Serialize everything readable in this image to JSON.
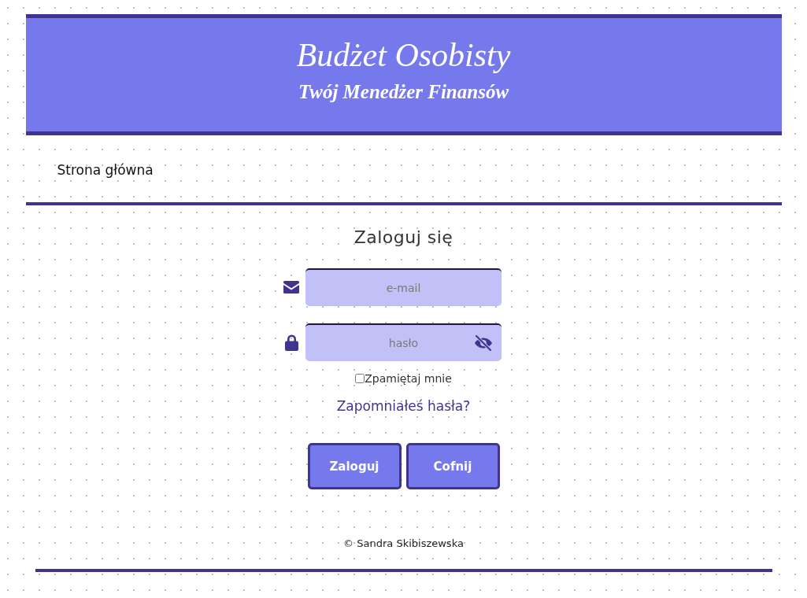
{
  "header": {
    "title": "Budżet Osobisty",
    "subtitle": "Twój Menedżer Finansów"
  },
  "nav": [
    {
      "label": "Strona główna"
    }
  ],
  "login": {
    "heading": "Zaloguj się",
    "fields": [
      {
        "kind": "email",
        "placeholder": "e-mail"
      },
      {
        "kind": "password",
        "placeholder": "hasło",
        "password_visible": false
      }
    ],
    "remember": {
      "label": "Zpamiętaj mnie",
      "checked": false
    },
    "forgot_link": "Zapomniałeś hasła?",
    "buttons": [
      "Zaloguj",
      "Cofnij"
    ]
  },
  "footer": {
    "text": "© Sandra Skibiszewska"
  }
}
